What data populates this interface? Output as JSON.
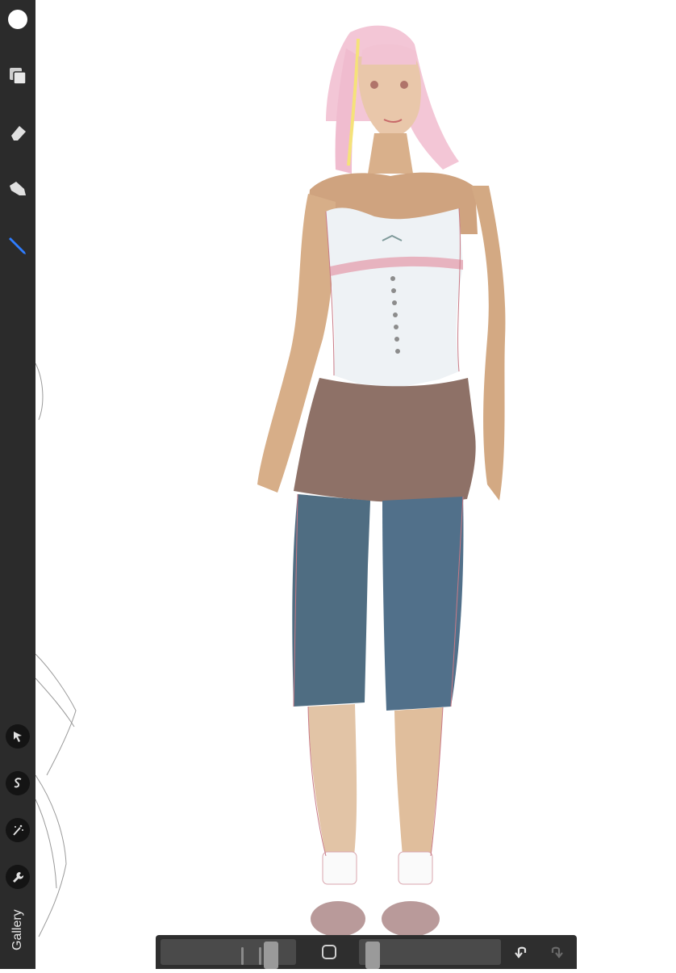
{
  "toolbar": {
    "top_tools": [
      {
        "name": "color-picker",
        "icon": "white-circle-icon"
      },
      {
        "name": "layers",
        "icon": "layers-icon"
      },
      {
        "name": "eraser",
        "icon": "eraser-icon"
      },
      {
        "name": "smudge",
        "icon": "smudge-icon"
      },
      {
        "name": "brush",
        "icon": "brush-icon",
        "active": true
      }
    ],
    "bottom_tools": [
      {
        "name": "transform",
        "icon": "arrow-cursor-icon"
      },
      {
        "name": "selection",
        "icon": "selection-s-icon"
      },
      {
        "name": "adjustments",
        "icon": "magic-wand-icon"
      },
      {
        "name": "actions",
        "icon": "wrench-icon"
      }
    ],
    "gallery_label": "Gallery"
  },
  "colors": {
    "toolbar_bg": "#2b2b2b",
    "active_tool": "#2f7dff",
    "canvas_bg": "#ffffff"
  },
  "bottom_bar": {
    "brush_size_slider_value": 0.85,
    "opacity_slider_value": 0.05
  }
}
